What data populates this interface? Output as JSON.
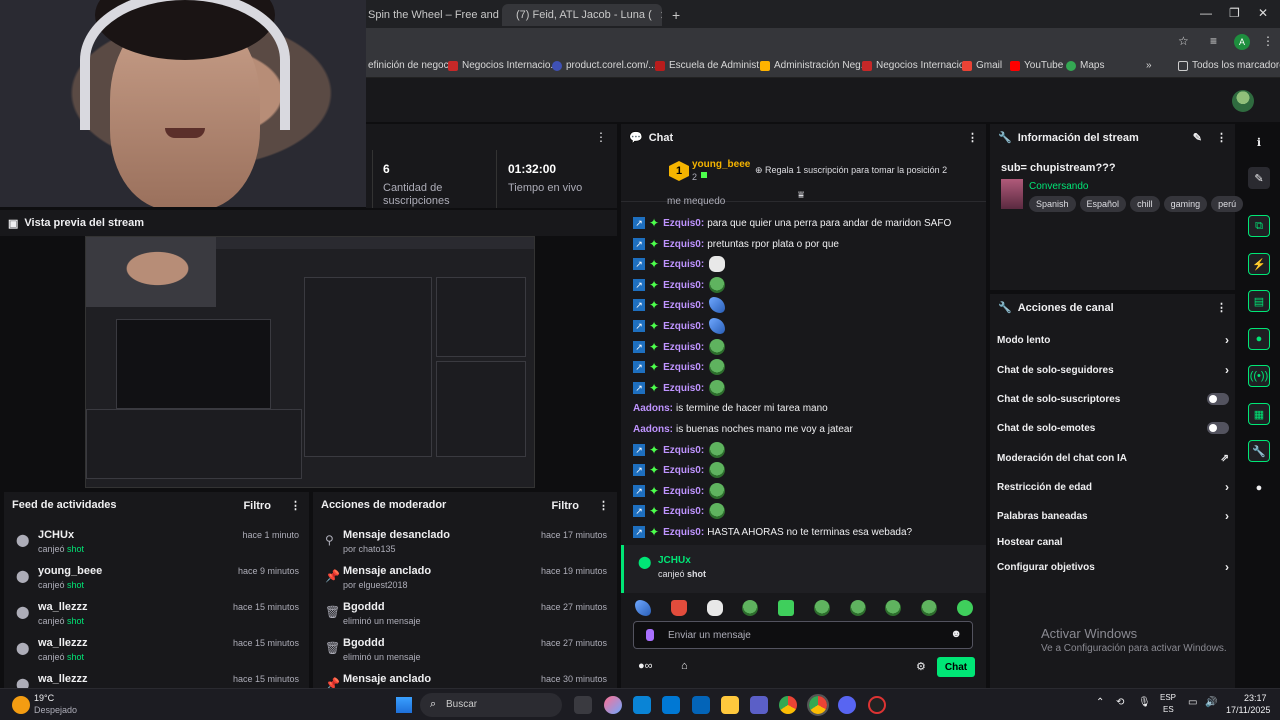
{
  "browser": {
    "tabs": [
      {
        "title": "Spin the Wheel – Free and easy"
      },
      {
        "title": "(7) Feid, ATL Jacob - Luna ("
      }
    ],
    "new_tab": "+",
    "bookmarks": [
      "efinición de negoc...",
      "Negocios Internacio...",
      "product.corel.com/...",
      "Escuela de Administ...",
      "Administración Neg...",
      "Negocios Internacio...",
      "Gmail",
      "YouTube",
      "Maps"
    ],
    "all_bookmarks": "Todos los marcadores",
    "profile_letter": "A"
  },
  "stats": [
    {
      "value": "6",
      "label": "Cantidad de suscripciones"
    },
    {
      "value": "01:32:00",
      "label": "Tiempo en vivo"
    }
  ],
  "preview": {
    "title": "Vista previa del stream"
  },
  "feed": {
    "title": "Feed de actividades",
    "filter": "Filtro",
    "items": [
      {
        "name": "JCHUx",
        "action": "canjeó",
        "item": "shot",
        "time": "hace 1 minuto"
      },
      {
        "name": "young_beee",
        "action": "canjeó",
        "item": "shot",
        "time": "hace 9 minutos"
      },
      {
        "name": "wa_llezzz",
        "action": "canjeó",
        "item": "shot",
        "time": "hace 15 minutos"
      },
      {
        "name": "wa_llezzz",
        "action": "canjeó",
        "item": "shot",
        "time": "hace 15 minutos"
      },
      {
        "name": "wa_llezzz",
        "action": "",
        "item": "",
        "time": "hace 15 minutos"
      }
    ]
  },
  "mod": {
    "title": "Acciones de moderador",
    "filter": "Filtro",
    "items": [
      {
        "title": "Mensaje desanclado",
        "by": "por chato135",
        "time": "hace 17 minutos"
      },
      {
        "title": "Mensaje anclado",
        "by": "por elguest2018",
        "time": "hace 19 minutos"
      },
      {
        "title": "Bgoddd",
        "by": "eliminó un mensaje",
        "time": "hace 27 minutos"
      },
      {
        "title": "Bgoddd",
        "by": "eliminó un mensaje",
        "time": "hace 27 minutos"
      },
      {
        "title": "Mensaje anclado",
        "by": "",
        "time": "hace 30 minutos"
      }
    ]
  },
  "chat": {
    "title": "Chat",
    "hype": {
      "rank": "1",
      "user": "young_beee",
      "count": "2",
      "message": "Regala 1 suscripción para tomar la posición 2"
    },
    "cut_line": "me mequedo",
    "messages": [
      {
        "user": "Ezquis0:",
        "text": "para que quier una perra para andar de maridon SAFO",
        "emote": ""
      },
      {
        "user": "Ezquis0:",
        "text": "pretuntas rpor plata o por que",
        "emote": ""
      },
      {
        "user": "Ezquis0:",
        "text": "",
        "emote": "skull"
      },
      {
        "user": "Ezquis0:",
        "text": "",
        "emote": "frog"
      },
      {
        "user": "Ezquis0:",
        "text": "",
        "emote": "butterfly"
      },
      {
        "user": "Ezquis0:",
        "text": "",
        "emote": "butterfly"
      },
      {
        "user": "Ezquis0:",
        "text": "",
        "emote": "frog"
      },
      {
        "user": "Ezquis0:",
        "text": "",
        "emote": "frog"
      },
      {
        "user": "Ezquis0:",
        "text": "",
        "emote": "frog"
      },
      {
        "user": "Aadons:",
        "text": "is termine de hacer mi tarea mano",
        "emote": "",
        "plain": true
      },
      {
        "user": "Aadons:",
        "text": "is buenas noches mano me voy a jatear",
        "emote": "",
        "plain": true
      },
      {
        "user": "Ezquis0:",
        "text": "",
        "emote": "frog"
      },
      {
        "user": "Ezquis0:",
        "text": "",
        "emote": "frog"
      },
      {
        "user": "Ezquis0:",
        "text": "",
        "emote": "frog"
      },
      {
        "user": "Ezquis0:",
        "text": "",
        "emote": "frog"
      },
      {
        "user": "Ezquis0:",
        "text": "HASTA AHORAS no te terminas esa webada?",
        "emote": ""
      }
    ],
    "redeem": {
      "user": "JCHUx",
      "action": "canjeó",
      "item": "shot"
    },
    "input_placeholder": "Enviar un mensaje",
    "send": "Chat"
  },
  "info": {
    "title": "Información del stream",
    "stream_title": "sub= chupistream???",
    "category": "Conversando",
    "tags": [
      "Spanish",
      "Español",
      "chill",
      "gaming",
      "perú"
    ]
  },
  "actions": {
    "title": "Acciones de canal",
    "items": [
      {
        "label": "Modo lento",
        "control": "chevron"
      },
      {
        "label": "Chat de solo-seguidores",
        "control": "chevron"
      },
      {
        "label": "Chat de solo-suscriptores",
        "control": "toggle"
      },
      {
        "label": "Chat de solo-emotes",
        "control": "toggle"
      },
      {
        "label": "Moderación del chat con IA",
        "control": "external"
      },
      {
        "label": "Restricción de edad",
        "control": "chevron"
      },
      {
        "label": "Palabras baneadas",
        "control": "chevron"
      },
      {
        "label": "Hostear canal",
        "control": "none"
      },
      {
        "label": "Configurar objetivos",
        "control": "chevron"
      }
    ]
  },
  "watermark": {
    "title": "Activar Windows",
    "subtitle": "Ve a Configuración para activar Windows."
  },
  "taskbar": {
    "temp": "19°C",
    "weather": "Despejado",
    "search": "Buscar",
    "lang1": "ESP",
    "lang2": "ES",
    "time": "23:17",
    "date": "17/11/2025"
  }
}
